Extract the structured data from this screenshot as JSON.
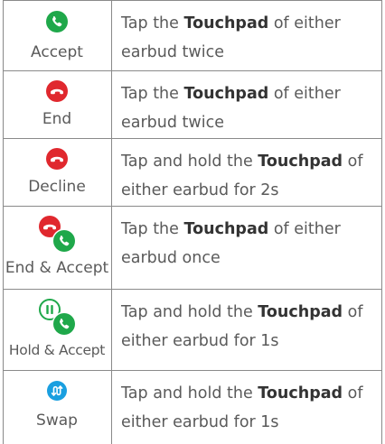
{
  "rows": [
    {
      "action": "Accept",
      "icon": "phone-accept-icon",
      "desc_before": "Tap the ",
      "desc_bold": "Touchpad",
      "desc_after": " of either earbud twice"
    },
    {
      "action": "End",
      "icon": "phone-end-icon",
      "desc_before": "Tap the ",
      "desc_bold": "Touchpad",
      "desc_after": " of either earbud twice"
    },
    {
      "action": "Decline",
      "icon": "phone-decline-icon",
      "desc_before": "Tap and hold the ",
      "desc_bold": "Touchpad",
      "desc_after": " of either earbud for 2s"
    },
    {
      "action": "End & Accept",
      "icon": "end-and-accept-icon",
      "desc_before": "Tap the ",
      "desc_bold": "Touchpad",
      "desc_after": " of either earbud once"
    },
    {
      "action": "Hold & Accept",
      "icon": "hold-and-accept-icon",
      "desc_before": "Tap and hold the ",
      "desc_bold": "Touchpad",
      "desc_after": " of either earbud for 1s"
    },
    {
      "action": "Swap",
      "icon": "swap-calls-icon",
      "desc_before": "Tap and hold the ",
      "desc_bold": "Touchpad",
      "desc_after": " of either earbud for 1s"
    }
  ],
  "colors": {
    "accept_green": "#1fa84a",
    "end_red": "#e0282e",
    "swap_blue": "#1a9fe0",
    "border": "#8a8a8a"
  }
}
